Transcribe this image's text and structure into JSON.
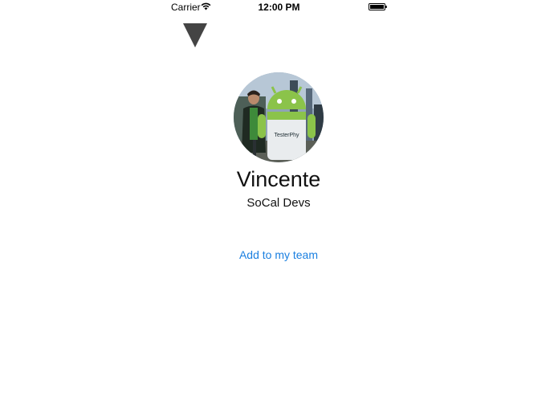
{
  "status_bar": {
    "carrier": "Carrier",
    "time": "12:00 PM",
    "wifi_icon": "wifi-icon",
    "battery_icon": "battery-icon"
  },
  "nav": {
    "dismiss_icon": "triangle-down-icon"
  },
  "profile": {
    "name": "Vincente",
    "team": "SoCal Devs",
    "avatar_logo_text": "TesterPhy"
  },
  "actions": {
    "add_to_team_label": "Add to my team"
  },
  "colors": {
    "link": "#1a7fe0",
    "triangle": "#444444",
    "text": "#111111"
  }
}
